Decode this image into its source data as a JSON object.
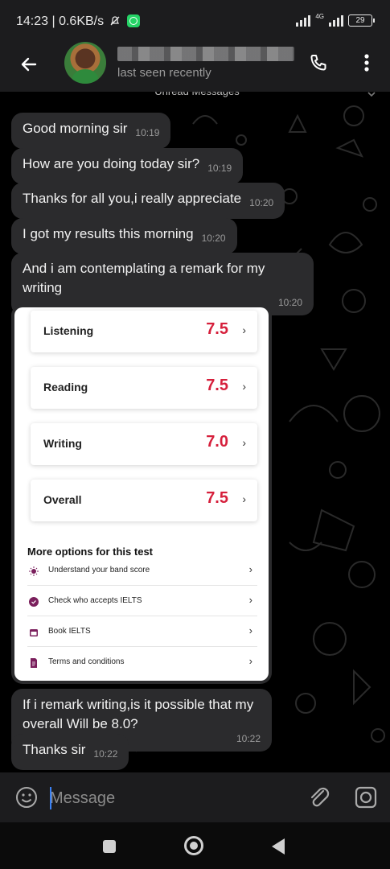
{
  "status_bar": {
    "time_and_speed": "14:23 | 0.6KB/s",
    "network": "4G",
    "battery": "29"
  },
  "header": {
    "last_seen": "last seen recently"
  },
  "chat": {
    "unread_banner": "Unread Messages",
    "messages": [
      {
        "text": "Good morning sir",
        "time": "10:19"
      },
      {
        "text": "How are you doing today sir?",
        "time": "10:19"
      },
      {
        "text": "Thanks for all you,i really appreciate",
        "time": "10:20"
      },
      {
        "text": "I got my results this morning",
        "time": "10:20"
      },
      {
        "text": "And i am contemplating a remark for my writing",
        "time": "10:20"
      },
      {
        "text": "If i remark writing,is it possible that my overall Will be 8.0?",
        "time": "10:22"
      },
      {
        "text": "Thanks sir",
        "time": "10:22"
      }
    ],
    "image_card": {
      "scores": [
        {
          "label": "Listening",
          "value": "7.5"
        },
        {
          "label": "Reading",
          "value": "7.5"
        },
        {
          "label": "Writing",
          "value": "7.0"
        },
        {
          "label": "Overall",
          "value": "7.5"
        }
      ],
      "options_title": "More options for this test",
      "options": [
        {
          "label": "Understand your band score",
          "icon": "bulb-icon"
        },
        {
          "label": "Check who accepts IELTS",
          "icon": "badge-icon"
        },
        {
          "label": "Book IELTS",
          "icon": "calendar-icon"
        },
        {
          "label": "Terms and conditions",
          "icon": "document-icon"
        }
      ],
      "accent_color": "#d6203c",
      "icon_color": "#7a1f5c"
    }
  },
  "composer": {
    "placeholder": "Message"
  }
}
